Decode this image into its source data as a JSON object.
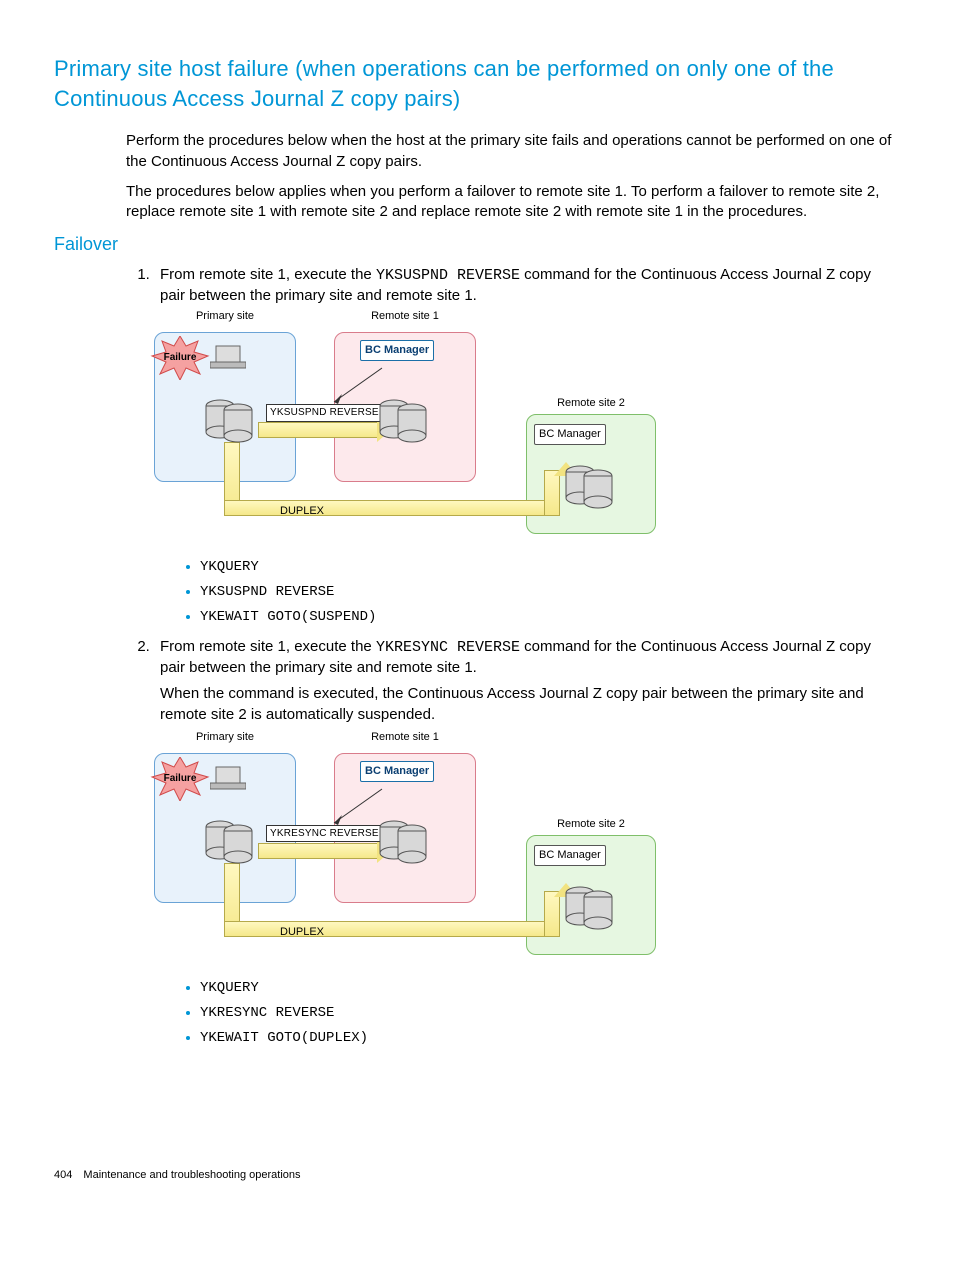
{
  "heading": "Primary site host failure (when operations can be performed on only one of the Continuous Access Journal Z copy pairs)",
  "intro_p1": "Perform the procedures below when the host at the primary site fails and operations cannot be performed on one of the Continuous Access Journal Z copy pairs.",
  "intro_p2": "The procedures below applies when you perform a failover to remote site 1. To perform a failover to remote site 2, replace remote site 1 with remote site 2 and replace remote site 2 with remote site 1 in the procedures.",
  "subheading": "Failover",
  "steps": [
    {
      "pre": "From remote site 1, execute the ",
      "cmd_inline": "YKSUSPND REVERSE",
      "post": " command for the Continuous Access Journal Z copy pair between the primary site and remote site 1.",
      "diagram_cmd": "YKSUSPND REVERSE",
      "cmds": [
        "YKQUERY",
        "YKSUSPND REVERSE",
        "YKEWAIT GOTO(SUSPEND)"
      ]
    },
    {
      "pre": "From remote site 1, execute the ",
      "cmd_inline": "YKRESYNC REVERSE",
      "post": " command for the Continuous Access Journal Z copy pair between the primary site and remote site 1.",
      "note": "When the command is executed, the Continuous Access Journal Z copy pair between the primary site and remote site 2 is automatically suspended.",
      "diagram_cmd": "YKRESYNC REVERSE",
      "cmds": [
        "YKQUERY",
        "YKRESYNC REVERSE",
        "YKEWAIT GOTO(DUPLEX)"
      ]
    }
  ],
  "diagram_labels": {
    "primary": "Primary site",
    "remote1": "Remote site 1",
    "remote2": "Remote site 2",
    "failure": "Failure",
    "bc_manager": "BC Manager",
    "duplex": "DUPLEX"
  },
  "footer": {
    "page": "404",
    "section": "Maintenance and troubleshooting operations"
  }
}
